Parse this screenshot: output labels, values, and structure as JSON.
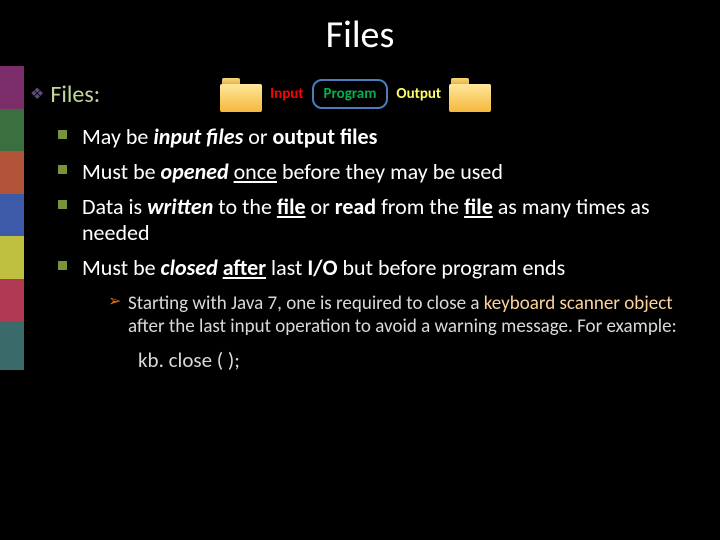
{
  "title": "Files",
  "section_label": "Files:",
  "diagram": {
    "input": "Input",
    "program": "Program",
    "output": "Output"
  },
  "bullets": {
    "b1": {
      "pre": "May be ",
      "e1": "input files",
      "mid": " or ",
      "e2": "output files"
    },
    "b2": {
      "pre": "Must be ",
      "e1": "opened",
      "sp": " ",
      "u1": "once",
      "post": " before they may be used"
    },
    "b3": {
      "pre": "Data is ",
      "e1": "written",
      "m1": " to the ",
      "u1": "file",
      "m2": " or ",
      "e2": "read",
      "m3": " from the ",
      "u2": "file",
      "post": " as many times as needed"
    },
    "b4": {
      "pre": "Must be ",
      "e1": "closed",
      "sp": " ",
      "u1": "after",
      "m1": " last ",
      "e2": "I/O",
      "post": " but before program ends"
    }
  },
  "sub": {
    "s1": {
      "p1": "Starting with Java 7, one is required to close a ",
      "kb": "keyboard scanner object",
      "p2": " after the last input operation to avoid a warning message.  For example:"
    }
  },
  "code": "kb. close ( );"
}
